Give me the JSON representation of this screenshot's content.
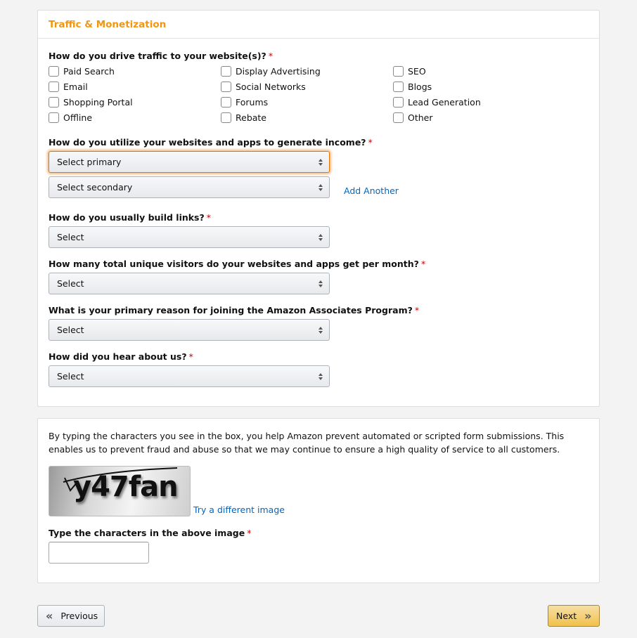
{
  "section_traffic": {
    "title": "Traffic & Monetization",
    "q_traffic": "How do you drive traffic to your website(s)?",
    "required_mark": "*",
    "traffic_options": [
      {
        "label": "Paid Search",
        "checked": false
      },
      {
        "label": "Email",
        "checked": false
      },
      {
        "label": "Shopping Portal",
        "checked": false
      },
      {
        "label": "Offline",
        "checked": false
      },
      {
        "label": "Display Advertising",
        "checked": false
      },
      {
        "label": "Social Networks",
        "checked": false
      },
      {
        "label": "Forums",
        "checked": false
      },
      {
        "label": "Rebate",
        "checked": false
      },
      {
        "label": "SEO",
        "checked": false
      },
      {
        "label": "Blogs",
        "checked": false
      },
      {
        "label": "Lead Generation",
        "checked": false
      },
      {
        "label": "Other",
        "checked": false
      }
    ],
    "q_income": "How do you utilize your websites and apps to generate income?",
    "income_primary": "Select primary",
    "income_secondary": "Select secondary",
    "add_another": "Add Another",
    "q_links": "How do you usually build links?",
    "links_value": "Select",
    "q_visitors": "How many total unique visitors do your websites and apps get per month?",
    "visitors_value": "Select",
    "q_reason": "What is your primary reason for joining the Amazon Associates Program?",
    "reason_value": "Select",
    "q_hear": "How did you hear about us?",
    "hear_value": "Select"
  },
  "section_captcha": {
    "description": "By typing the characters you see in the box, you help Amazon prevent automated or scripted form submissions. This enables us to prevent fraud and abuse so that we may continue to ensure a high quality of service to all customers.",
    "captcha_text": "y47fan",
    "try_different": "Try a different image",
    "input_label": "Type the characters in the above image",
    "input_value": ""
  },
  "nav": {
    "previous": "Previous",
    "next": "Next"
  },
  "colors": {
    "accent_orange": "#f29611",
    "link_blue": "#0066c0",
    "required_red": "#c40000",
    "next_button": "#f0c14b"
  }
}
